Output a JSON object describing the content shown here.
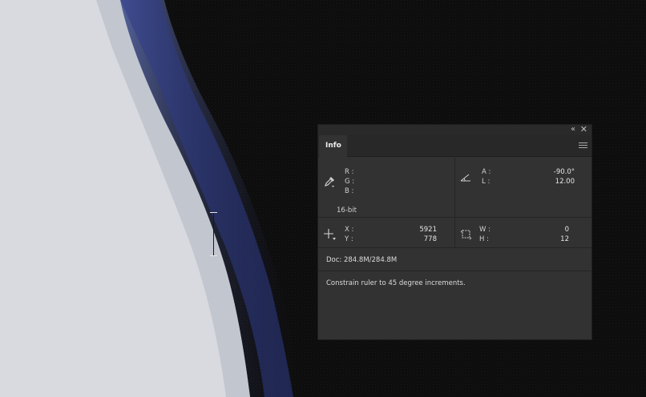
{
  "panel": {
    "tab": "Info",
    "color_readout": {
      "r_label": "R :",
      "g_label": "G :",
      "b_label": "B :",
      "bit_depth": "16-bit"
    },
    "angle_readout": {
      "a_label": "A :",
      "a_value": "-90.0°",
      "l_label": "L :",
      "l_value": "12.00"
    },
    "position_readout": {
      "x_label": "X :",
      "x_value": "5921",
      "y_label": "Y :",
      "y_value": "778"
    },
    "size_readout": {
      "w_label": "W :",
      "w_value": "0",
      "h_label": "H :",
      "h_value": "12"
    },
    "doc_size": "Doc: 284.8M/284.8M",
    "hint": "Constrain ruler to 45 degree increments."
  },
  "icons": {
    "collapse": "double-chevron-left-icon",
    "close": "close-icon",
    "menu": "panel-menu-icon",
    "eyedropper": "eyedropper-icon",
    "angle": "angle-icon",
    "crosshair": "crosshair-icon",
    "selection": "selection-size-icon"
  },
  "colors": {
    "panel_bg": "#323232",
    "canvas_dark": "#0d0d0d",
    "canvas_light": "#d8dadf",
    "canvas_edge": "#3a4a9a"
  }
}
